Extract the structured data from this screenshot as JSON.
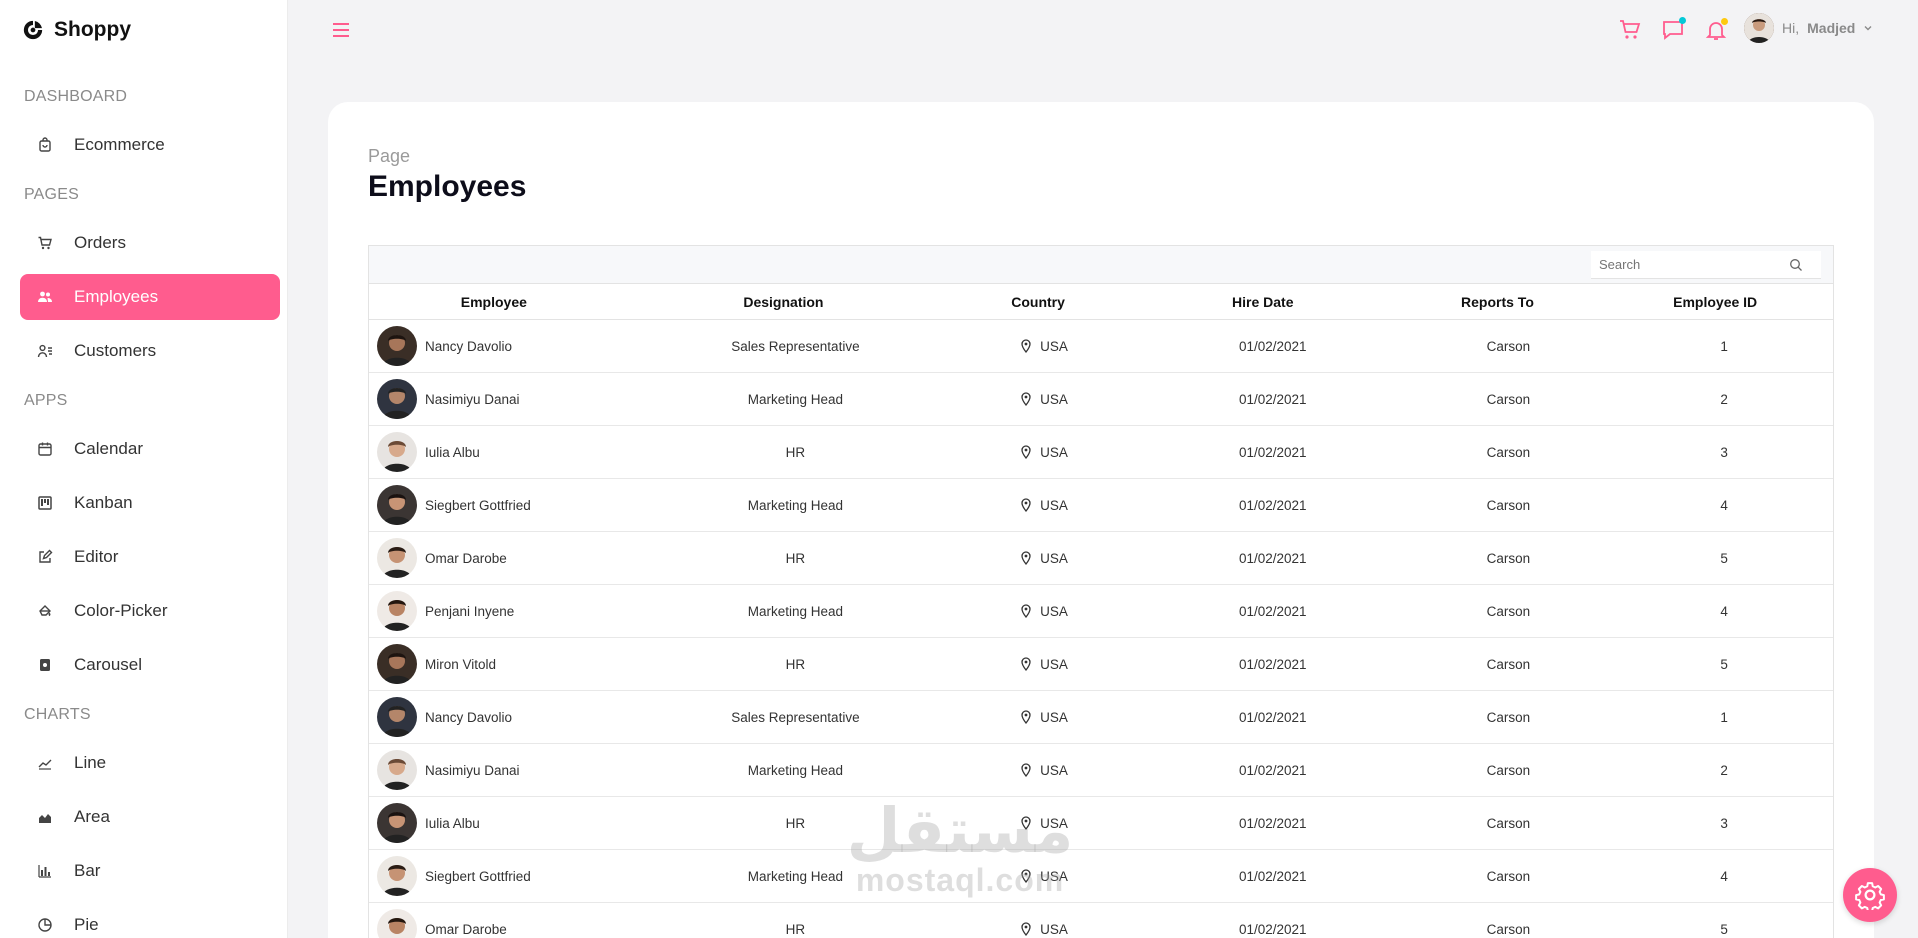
{
  "brand": {
    "name": "Shoppy"
  },
  "sidebar": {
    "sections": [
      {
        "title": "DASHBOARD",
        "items": [
          {
            "label": "Ecommerce",
            "icon": "shopping-bag-icon"
          }
        ]
      },
      {
        "title": "PAGES",
        "items": [
          {
            "label": "Orders",
            "icon": "cart-icon"
          },
          {
            "label": "Employees",
            "icon": "people-icon",
            "active": true
          },
          {
            "label": "Customers",
            "icon": "user-list-icon"
          }
        ]
      },
      {
        "title": "APPS",
        "items": [
          {
            "label": "Calendar",
            "icon": "calendar-icon"
          },
          {
            "label": "Kanban",
            "icon": "kanban-icon"
          },
          {
            "label": "Editor",
            "icon": "edit-icon"
          },
          {
            "label": "Color-Picker",
            "icon": "paint-bucket-icon"
          },
          {
            "label": "Carousel",
            "icon": "carousel-icon"
          }
        ]
      },
      {
        "title": "CHARTS",
        "items": [
          {
            "label": "Line",
            "icon": "line-chart-icon"
          },
          {
            "label": "Area",
            "icon": "area-chart-icon"
          },
          {
            "label": "Bar",
            "icon": "bar-chart-icon"
          },
          {
            "label": "Pie",
            "icon": "pie-chart-icon"
          }
        ]
      }
    ]
  },
  "header": {
    "greeting": "Hi,",
    "username": "Madjed",
    "colors": {
      "accent": "#ff5c8e",
      "chat_dot": "#03c9d7",
      "bell_dot": "#fec90f"
    }
  },
  "page": {
    "subtitle": "Page",
    "title": "Employees"
  },
  "grid": {
    "search_placeholder": "Search",
    "columns": [
      "Employee",
      "Designation",
      "Country",
      "Hire Date",
      "Reports To",
      "Employee ID"
    ],
    "rows": [
      {
        "name": "Nancy Davolio",
        "designation": "Sales Representative",
        "country": "USA",
        "hire_date": "01/02/2021",
        "reports_to": "Carson",
        "id": "1"
      },
      {
        "name": "Nasimiyu Danai",
        "designation": "Marketing Head",
        "country": "USA",
        "hire_date": "01/02/2021",
        "reports_to": "Carson",
        "id": "2"
      },
      {
        "name": "Iulia Albu",
        "designation": "HR",
        "country": "USA",
        "hire_date": "01/02/2021",
        "reports_to": "Carson",
        "id": "3"
      },
      {
        "name": "Siegbert Gottfried",
        "designation": "Marketing Head",
        "country": "USA",
        "hire_date": "01/02/2021",
        "reports_to": "Carson",
        "id": "4"
      },
      {
        "name": "Omar Darobe",
        "designation": "HR",
        "country": "USA",
        "hire_date": "01/02/2021",
        "reports_to": "Carson",
        "id": "5"
      },
      {
        "name": "Penjani Inyene",
        "designation": "Marketing Head",
        "country": "USA",
        "hire_date": "01/02/2021",
        "reports_to": "Carson",
        "id": "4"
      },
      {
        "name": "Miron Vitold",
        "designation": "HR",
        "country": "USA",
        "hire_date": "01/02/2021",
        "reports_to": "Carson",
        "id": "5"
      },
      {
        "name": "Nancy Davolio",
        "designation": "Sales Representative",
        "country": "USA",
        "hire_date": "01/02/2021",
        "reports_to": "Carson",
        "id": "1"
      },
      {
        "name": "Nasimiyu Danai",
        "designation": "Marketing Head",
        "country": "USA",
        "hire_date": "01/02/2021",
        "reports_to": "Carson",
        "id": "2"
      },
      {
        "name": "Iulia Albu",
        "designation": "HR",
        "country": "USA",
        "hire_date": "01/02/2021",
        "reports_to": "Carson",
        "id": "3"
      },
      {
        "name": "Siegbert Gottfried",
        "designation": "Marketing Head",
        "country": "USA",
        "hire_date": "01/02/2021",
        "reports_to": "Carson",
        "id": "4"
      },
      {
        "name": "Omar Darobe",
        "designation": "HR",
        "country": "USA",
        "hire_date": "01/02/2021",
        "reports_to": "Carson",
        "id": "5"
      }
    ]
  },
  "watermark": {
    "arabic": "مستقل",
    "latin": "mostaql.com"
  }
}
